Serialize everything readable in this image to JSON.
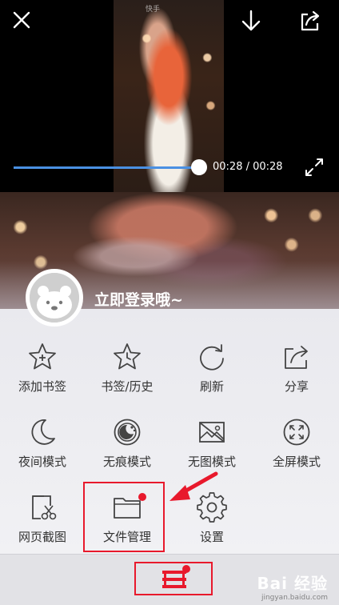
{
  "video": {
    "watermark": "快手",
    "time_current": "00:28",
    "time_total": "00:28",
    "time_display": "00:28 / 00:28",
    "progress_fraction": 1.0,
    "accent_color": "#4a90e2"
  },
  "login": {
    "prompt": "立即登录哦~"
  },
  "menu": {
    "items": [
      {
        "label": "添加书签",
        "icon": "star-plus-icon"
      },
      {
        "label": "书签/历史",
        "icon": "star-clock-icon"
      },
      {
        "label": "刷新",
        "icon": "refresh-icon"
      },
      {
        "label": "分享",
        "icon": "share-icon"
      },
      {
        "label": "夜间模式",
        "icon": "moon-icon"
      },
      {
        "label": "无痕模式",
        "icon": "incognito-icon"
      },
      {
        "label": "无图模式",
        "icon": "no-image-icon"
      },
      {
        "label": "全屏模式",
        "icon": "fullscreen-icon"
      },
      {
        "label": "网页截图",
        "icon": "screenshot-scissors-icon"
      },
      {
        "label": "文件管理",
        "icon": "folder-icon"
      },
      {
        "label": "设置",
        "icon": "gear-icon"
      }
    ]
  },
  "highlight_color": "#e8192c",
  "footer_watermark": {
    "brand": "Bai 经验",
    "url": "jingyan.baidu.com"
  }
}
